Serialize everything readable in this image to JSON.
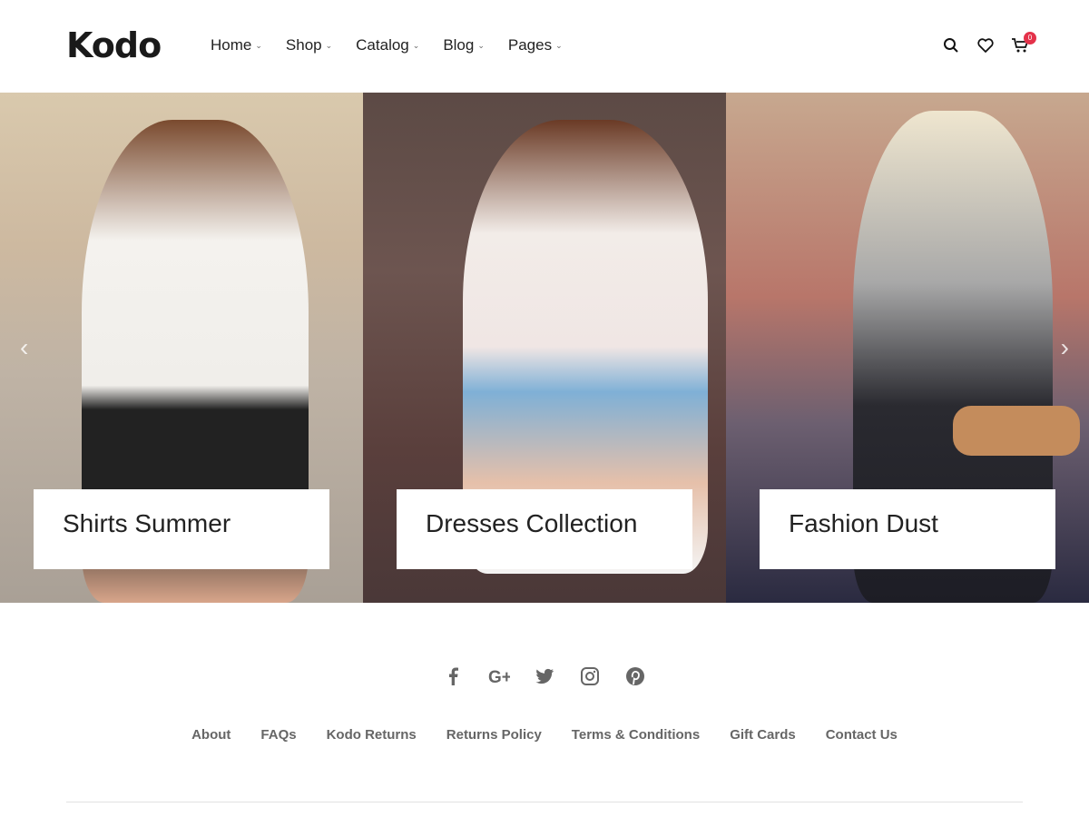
{
  "header": {
    "logo": "Kodo",
    "nav": [
      {
        "label": "Home"
      },
      {
        "label": "Shop"
      },
      {
        "label": "Catalog"
      },
      {
        "label": "Blog"
      },
      {
        "label": "Pages"
      }
    ],
    "cart_count": "0"
  },
  "banners": [
    {
      "title": "Shirts Summer"
    },
    {
      "title": "Dresses Collection"
    },
    {
      "title": "Fashion Dust"
    }
  ],
  "social": [
    "facebook-icon",
    "google-plus-icon",
    "twitter-icon",
    "instagram-icon",
    "pinterest-icon"
  ],
  "footer_links": [
    "About",
    "FAQs",
    "Kodo Returns",
    "Returns Policy",
    "Terms & Conditions",
    "Gift Cards",
    "Contact Us"
  ],
  "colors": {
    "badge": "#e4324a",
    "text": "#222222",
    "muted": "#666666"
  }
}
